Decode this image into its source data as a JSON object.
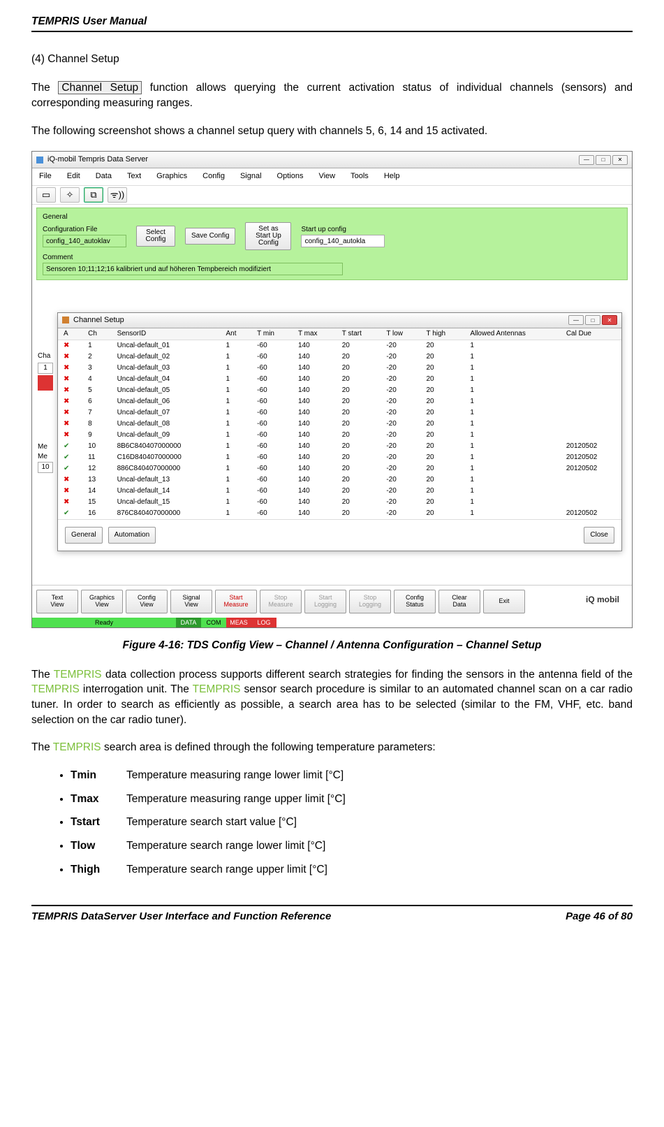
{
  "doc": {
    "header": "TEMPRIS User Manual",
    "footer_left": "TEMPRIS DataServer User Interface and Function Reference",
    "footer_right": "Page 46 of 80"
  },
  "text": {
    "section_num": "(4) Channel Setup",
    "p1_a": "The ",
    "p1_btn": "Channel Setup",
    "p1_b": " function allows querying the current activation status of individual channels (sensors) and corresponding measuring ranges.",
    "p2": "The following screenshot shows a channel setup query with channels 5, 6, 14 and 15 activated.",
    "fig_caption": "Figure 4-16: TDS Config View – Channel / Antenna Configuration – Channel Setup",
    "p3_a": "The ",
    "p3_brand": "TEMPRIS",
    "p3_b": " data collection process supports different search strategies for finding the sensors in the antenna field of the ",
    "p3_c": " interrogation unit. The ",
    "p3_d": " sensor search procedure is similar to an automated channel scan on a car radio tuner. In order to search as efficiently as possible, a search area has to be selected (similar to the FM, VHF, etc. band selection on the car radio tuner).",
    "p4_a": "The ",
    "p4_b": " search area is defined through the following temperature parameters:",
    "params": [
      {
        "k": "Tmin",
        "v": "Temperature measuring range lower limit [°C]"
      },
      {
        "k": "Tmax",
        "v": "Temperature measuring range upper limit [°C]"
      },
      {
        "k": "Tstart",
        "v": "Temperature search start value [°C]"
      },
      {
        "k": "Tlow",
        "v": "Temperature search range lower limit [°C]"
      },
      {
        "k": "Thigh",
        "v": "Temperature search range upper limit [°C]"
      }
    ]
  },
  "shot": {
    "main_title": "iQ-mobil Tempris Data Server",
    "menus": [
      "File",
      "Edit",
      "Data",
      "Text",
      "Graphics",
      "Config",
      "Signal",
      "Options",
      "View",
      "Tools",
      "Help"
    ],
    "general_lbl": "General",
    "conf_file_lbl": "Configuration File",
    "conf_file_val": "config_140_autoklav",
    "btn_select": "Select Config",
    "btn_save": "Save Config",
    "btn_startcfg": "Set as Start Up Config",
    "startup_lbl": "Start up config",
    "startup_val": "config_140_autokla",
    "comment_lbl": "Comment",
    "comment_val": "Sensoren 10;11;12;16 kalibriert und auf höheren Tempbereich modifiziert",
    "inner_title": "Channel Setup",
    "cols": [
      "A",
      "Ch",
      "SensorID",
      "Ant",
      "T min",
      "T max",
      "T start",
      "T low",
      "T high",
      "Allowed Antennas",
      "Cal Due"
    ],
    "rows": [
      {
        "a": "x",
        "ch": "1",
        "id": "Uncal-default_01",
        "ant": "1",
        "tmin": "-60",
        "tmax": "140",
        "ts": "20",
        "tl": "-20",
        "th": "20",
        "aa": "1",
        "cd": ""
      },
      {
        "a": "x",
        "ch": "2",
        "id": "Uncal-default_02",
        "ant": "1",
        "tmin": "-60",
        "tmax": "140",
        "ts": "20",
        "tl": "-20",
        "th": "20",
        "aa": "1",
        "cd": ""
      },
      {
        "a": "x",
        "ch": "3",
        "id": "Uncal-default_03",
        "ant": "1",
        "tmin": "-60",
        "tmax": "140",
        "ts": "20",
        "tl": "-20",
        "th": "20",
        "aa": "1",
        "cd": ""
      },
      {
        "a": "x",
        "ch": "4",
        "id": "Uncal-default_04",
        "ant": "1",
        "tmin": "-60",
        "tmax": "140",
        "ts": "20",
        "tl": "-20",
        "th": "20",
        "aa": "1",
        "cd": ""
      },
      {
        "a": "x",
        "ch": "5",
        "id": "Uncal-default_05",
        "ant": "1",
        "tmin": "-60",
        "tmax": "140",
        "ts": "20",
        "tl": "-20",
        "th": "20",
        "aa": "1",
        "cd": ""
      },
      {
        "a": "x",
        "ch": "6",
        "id": "Uncal-default_06",
        "ant": "1",
        "tmin": "-60",
        "tmax": "140",
        "ts": "20",
        "tl": "-20",
        "th": "20",
        "aa": "1",
        "cd": ""
      },
      {
        "a": "x",
        "ch": "7",
        "id": "Uncal-default_07",
        "ant": "1",
        "tmin": "-60",
        "tmax": "140",
        "ts": "20",
        "tl": "-20",
        "th": "20",
        "aa": "1",
        "cd": ""
      },
      {
        "a": "x",
        "ch": "8",
        "id": "Uncal-default_08",
        "ant": "1",
        "tmin": "-60",
        "tmax": "140",
        "ts": "20",
        "tl": "-20",
        "th": "20",
        "aa": "1",
        "cd": ""
      },
      {
        "a": "x",
        "ch": "9",
        "id": "Uncal-default_09",
        "ant": "1",
        "tmin": "-60",
        "tmax": "140",
        "ts": "20",
        "tl": "-20",
        "th": "20",
        "aa": "1",
        "cd": ""
      },
      {
        "a": "v",
        "ch": "10",
        "id": "8B6C840407000000",
        "ant": "1",
        "tmin": "-60",
        "tmax": "140",
        "ts": "20",
        "tl": "-20",
        "th": "20",
        "aa": "1",
        "cd": "20120502"
      },
      {
        "a": "v",
        "ch": "11",
        "id": "C16D840407000000",
        "ant": "1",
        "tmin": "-60",
        "tmax": "140",
        "ts": "20",
        "tl": "-20",
        "th": "20",
        "aa": "1",
        "cd": "20120502"
      },
      {
        "a": "v",
        "ch": "12",
        "id": "886C840407000000",
        "ant": "1",
        "tmin": "-60",
        "tmax": "140",
        "ts": "20",
        "tl": "-20",
        "th": "20",
        "aa": "1",
        "cd": "20120502"
      },
      {
        "a": "x",
        "ch": "13",
        "id": "Uncal-default_13",
        "ant": "1",
        "tmin": "-60",
        "tmax": "140",
        "ts": "20",
        "tl": "-20",
        "th": "20",
        "aa": "1",
        "cd": ""
      },
      {
        "a": "x",
        "ch": "14",
        "id": "Uncal-default_14",
        "ant": "1",
        "tmin": "-60",
        "tmax": "140",
        "ts": "20",
        "tl": "-20",
        "th": "20",
        "aa": "1",
        "cd": ""
      },
      {
        "a": "x",
        "ch": "15",
        "id": "Uncal-default_15",
        "ant": "1",
        "tmin": "-60",
        "tmax": "140",
        "ts": "20",
        "tl": "-20",
        "th": "20",
        "aa": "1",
        "cd": ""
      },
      {
        "a": "v",
        "ch": "16",
        "id": "876C840407000000",
        "ant": "1",
        "tmin": "-60",
        "tmax": "140",
        "ts": "20",
        "tl": "-20",
        "th": "20",
        "aa": "1",
        "cd": "20120502"
      }
    ],
    "btn_general": "General",
    "btn_auto": "Automation",
    "btn_close": "Close",
    "bottom_btns": [
      {
        "t": "Text\nView",
        "cls": ""
      },
      {
        "t": "Graphics\nView",
        "cls": ""
      },
      {
        "t": "Config\nView",
        "cls": ""
      },
      {
        "t": "Signal\nView",
        "cls": ""
      },
      {
        "t": "Start\nMeasure",
        "cls": "red"
      },
      {
        "t": "Stop\nMeasure",
        "cls": "dis"
      },
      {
        "t": "Start\nLogging",
        "cls": "dis"
      },
      {
        "t": "Stop\nLogging",
        "cls": "dis"
      },
      {
        "t": "Config\nStatus",
        "cls": ""
      },
      {
        "t": "Clear\nData",
        "cls": ""
      },
      {
        "t": "Exit",
        "cls": ""
      }
    ],
    "status": {
      "ready": "Ready",
      "data": "DATA",
      "com": "COM",
      "meas": "MEAS",
      "log": "LOG"
    },
    "side": {
      "cha": "Cha",
      "one": "1",
      "me1": "Me",
      "me2": "Me",
      "ten": "10"
    },
    "logo": "iQ mobil"
  }
}
